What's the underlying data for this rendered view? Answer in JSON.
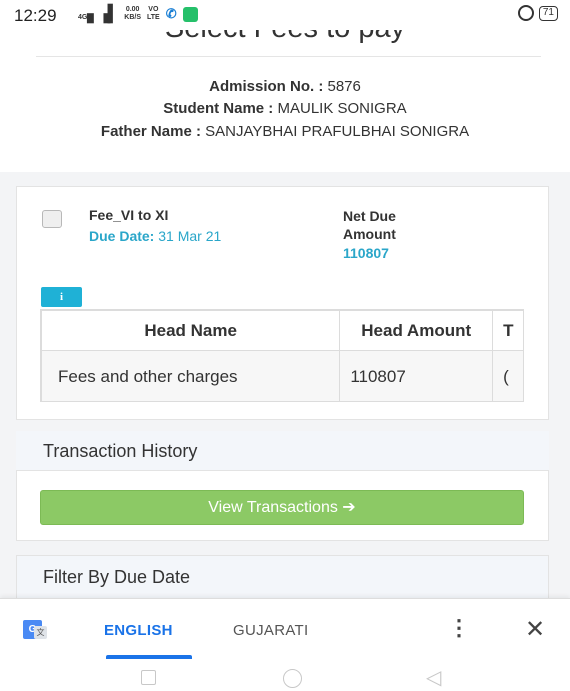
{
  "status_bar": {
    "time": "12:29",
    "net_label": "4G",
    "speed": "0.00",
    "speed_unit": "KB/S",
    "volte_top": "VO",
    "volte_bottom": "LTE",
    "battery": "71"
  },
  "page": {
    "title": "Select Fees to pay"
  },
  "student": {
    "admission_label": "Admission No. :",
    "admission_value": "5876",
    "name_label": "Student Name :",
    "name_value": "MAULIK SONIGRA",
    "father_label": "Father Name :",
    "father_value": "SANJAYBHAI PRAFULBHAI SONIGRA"
  },
  "fee_item": {
    "name": "Fee_VI to XI",
    "due_date_label": "Due Date:",
    "due_date_value": "31 Mar 21",
    "net_due_label": "Net Due Amount",
    "net_due_value": "110807",
    "info_button": "i",
    "table": {
      "headers": [
        "Head Name",
        "Head Amount",
        "T"
      ],
      "rows": [
        [
          "Fees and other charges",
          "110807",
          "("
        ]
      ]
    }
  },
  "transaction_history": {
    "title": "Transaction History",
    "button_label": "View Transactions ➔"
  },
  "filter": {
    "title": "Filter By Due Date"
  },
  "translate_bar": {
    "lang_active": "ENGLISH",
    "lang_other": "GUJARATI",
    "more": "⋮",
    "close": "✕"
  },
  "nav_bar": {
    "back": "◁"
  }
}
